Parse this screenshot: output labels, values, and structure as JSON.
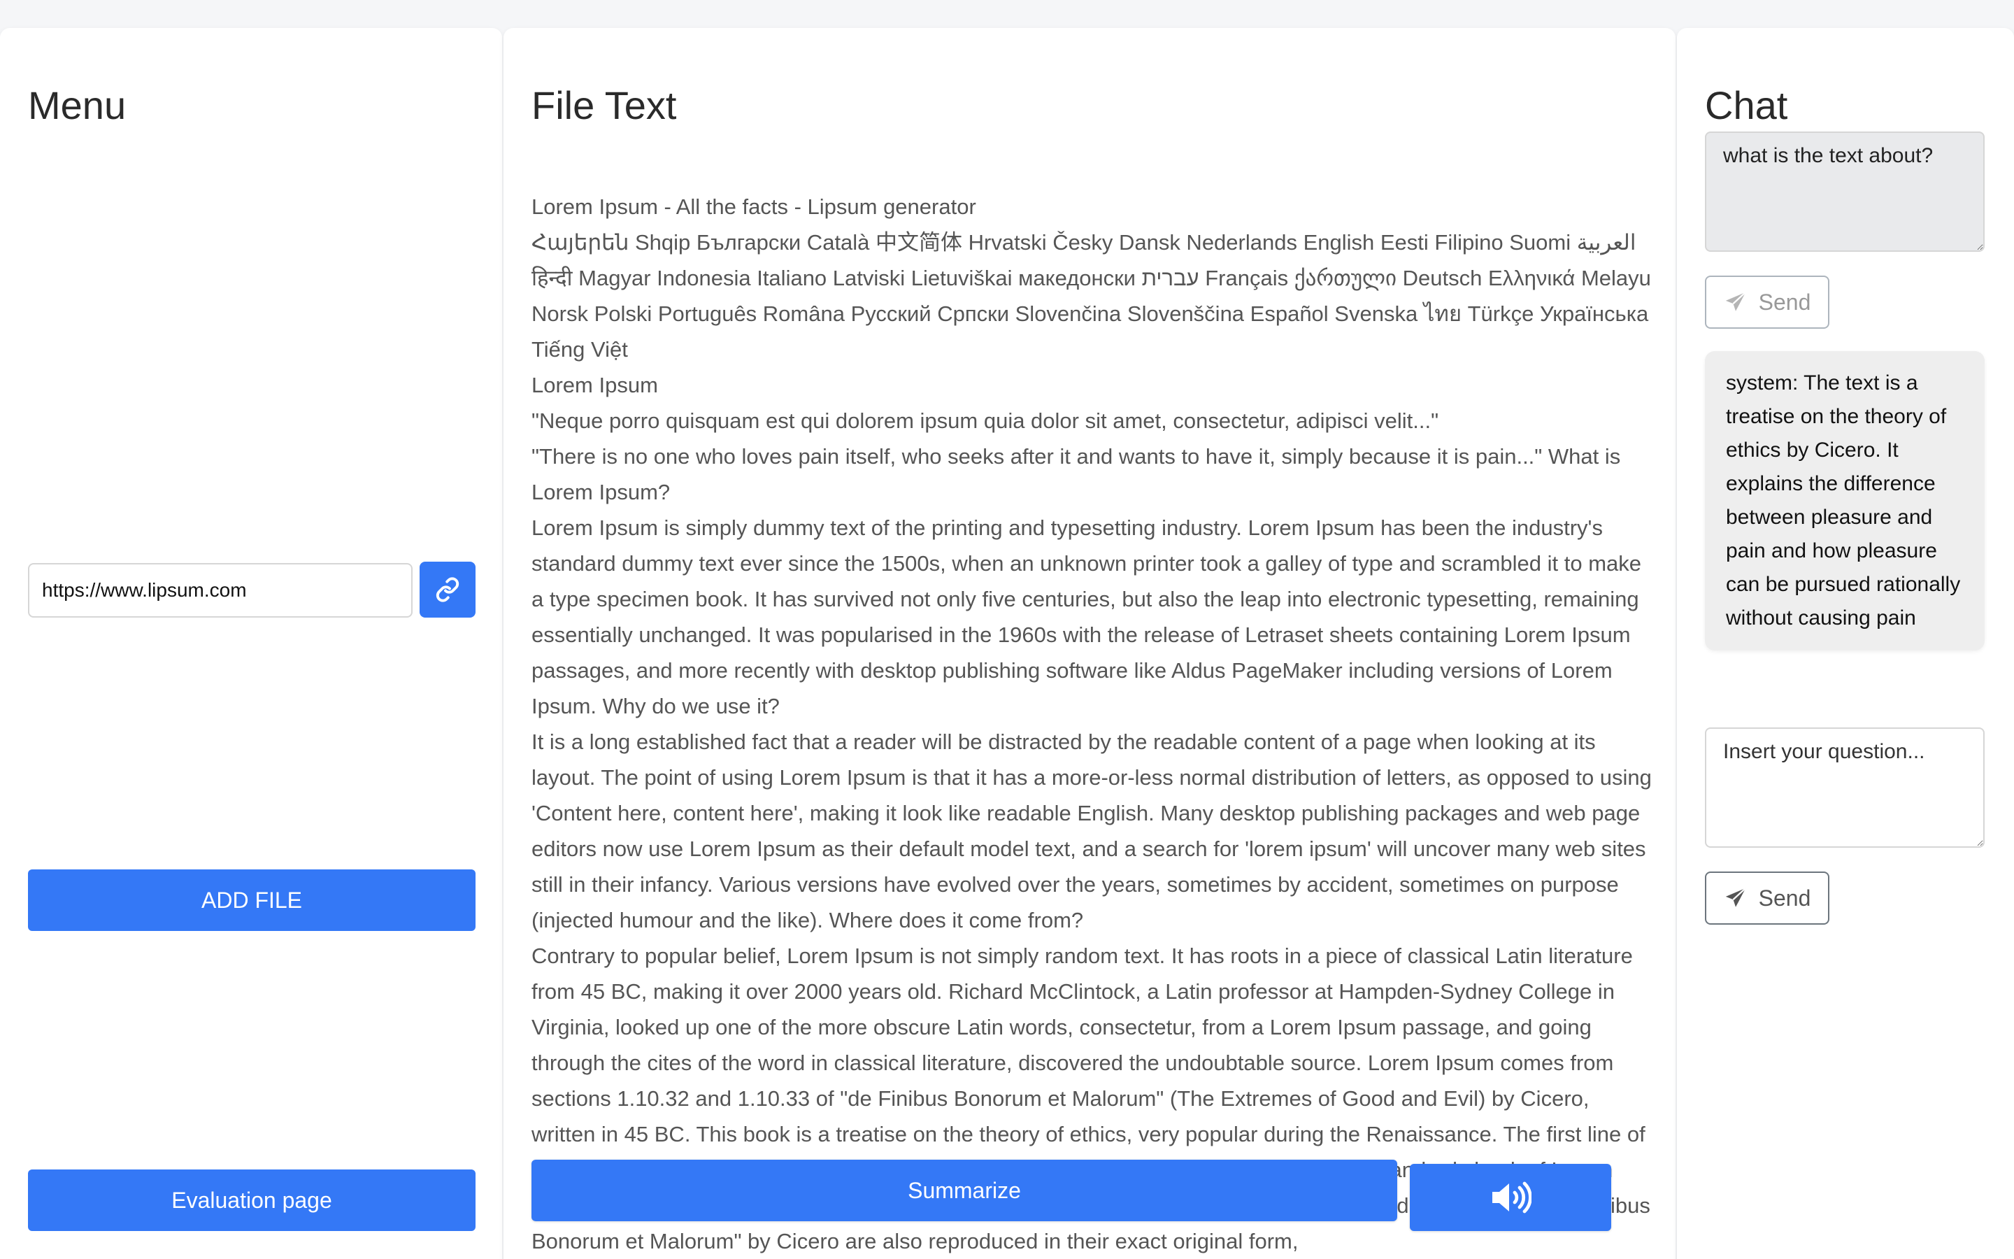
{
  "menu": {
    "title": "Menu",
    "url_value": "https://www.lipsum.com",
    "add_file_label": "ADD FILE",
    "evaluation_label": "Evaluation page",
    "link_icon": "link-icon"
  },
  "file": {
    "title": "File Text",
    "paragraphs": [
      "Lorem Ipsum - All the facts - Lipsum generator",
      "Հայերեն Shqip Български Català 中文简体 Hrvatski Česky Dansk Nederlands English Eesti Filipino Suomi العربية हिन्दी Magyar Indonesia Italiano Latviski Lietuviškai македонски עברית Français ქართული Deutsch Ελληνικά Melayu Norsk Polski Português Româna Русский Српски Slovenčina Slovenščina Español Svenska ไทย Türkçe Українська Tiếng Việt",
      "Lorem Ipsum",
      "\"Neque porro quisquam est qui dolorem ipsum quia dolor sit amet, consectetur, adipisci velit...\"",
      "\"There is no one who loves pain itself, who seeks after it and wants to have it, simply because it is pain...\" What is Lorem Ipsum?",
      "Lorem Ipsum is simply dummy text of the printing and typesetting industry. Lorem Ipsum has been the industry's standard dummy text ever since the 1500s, when an unknown printer took a galley of type and scrambled it to make a type specimen book. It has survived not only five centuries, but also the leap into electronic typesetting, remaining essentially unchanged. It was popularised in the 1960s with the release of Letraset sheets containing Lorem Ipsum passages, and more recently with desktop publishing software like Aldus PageMaker including versions of Lorem Ipsum. Why do we use it?",
      "It is a long established fact that a reader will be distracted by the readable content of a page when looking at its layout. The point of using Lorem Ipsum is that it has a more-or-less normal distribution of letters, as opposed to using 'Content here, content here', making it look like readable English. Many desktop publishing packages and web page editors now use Lorem Ipsum as their default model text, and a search for 'lorem ipsum' will uncover many web sites still in their infancy. Various versions have evolved over the years, sometimes by accident, sometimes on purpose (injected humour and the like). Where does it come from?",
      "Contrary to popular belief, Lorem Ipsum is not simply random text. It has roots in a piece of classical Latin literature from 45 BC, making it over 2000 years old. Richard McClintock, a Latin professor at Hampden-Sydney College in Virginia, looked up one of the more obscure Latin words, consectetur, from a Lorem Ipsum passage, and going through the cites of the word in classical literature, discovered the undoubtable source. Lorem Ipsum comes from sections 1.10.32 and 1.10.33 of \"de Finibus Bonorum et Malorum\" (The Extremes of Good and Evil) by Cicero, written in 45 BC. This book is a treatise on the theory of ethics, very popular during the Renaissance. The first line of Lorem Ipsum, \"Lorem ipsum dolor sit amet..\", comes from a line in section 1.10.32. The standard chunk of Lorem Ipsum used since the 1500s is reproduced below for those interested. Sections 1.10.32 and 1.10.33 from \"de Finibus Bonorum et Malorum\" by Cicero are also reproduced in their exact original form,"
    ],
    "summarize_label": "Summarize",
    "speaker_icon": "speaker-icon"
  },
  "chat": {
    "title": "Chat",
    "question_value": "what is the text about?",
    "send_label": "Send",
    "reply_text": "system: The text is a treatise on the theory of ethics by Cicero. It explains the difference between pleasure and pain and how pleasure can be pursued rationally without causing pain",
    "input_placeholder": "Insert your question...",
    "send_icon": "paper-plane-icon"
  },
  "colors": {
    "primary": "#3478f6",
    "panel_bg": "#ffffff",
    "page_bg": "#f5f6f8",
    "bubble_bg": "#eeeeee"
  }
}
